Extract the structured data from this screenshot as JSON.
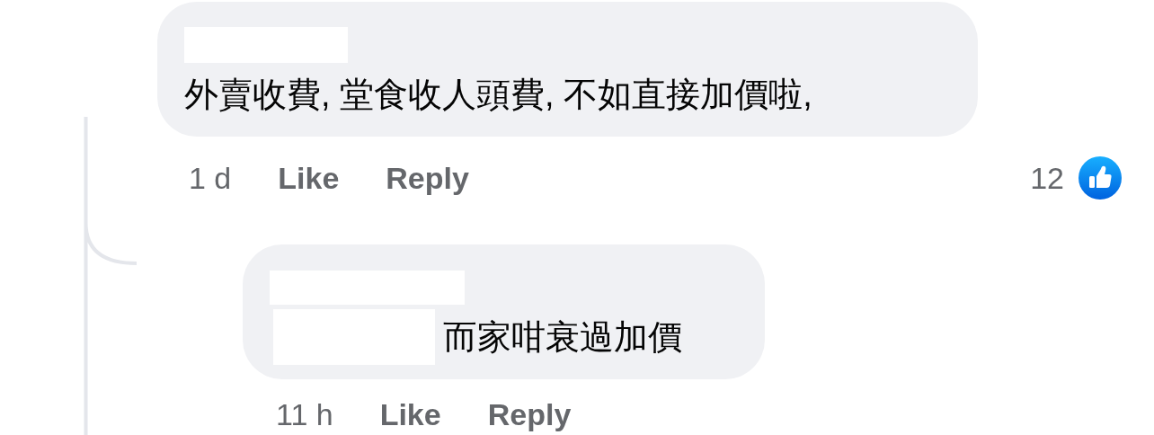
{
  "comments": [
    {
      "kind": "comment",
      "text": "外賣收費, 堂食收人頭費, 不如直接加價啦,",
      "time": "1 d",
      "like": "Like",
      "reply": "Reply",
      "reaction_count": "12",
      "children": [
        {
          "kind": "reply",
          "text": "而家咁衰過加價",
          "time": "11 h",
          "like": "Like",
          "reply": "Reply"
        }
      ]
    }
  ]
}
